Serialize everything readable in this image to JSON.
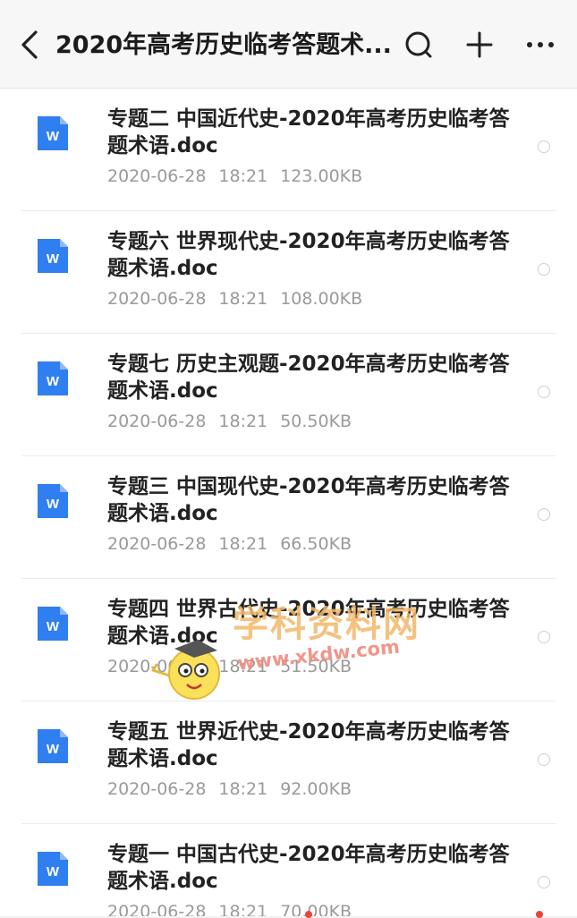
{
  "header": {
    "title": "2020年高考历史临考答题术...",
    "icons": [
      "back-icon",
      "search-icon",
      "add-icon",
      "more-icon"
    ]
  },
  "files": [
    {
      "name": "专题二 中国近代史-2020年高考历史临考答题术语.doc",
      "date": "2020-06-28",
      "time": "18:21",
      "size": "123.00KB"
    },
    {
      "name": "专题六 世界现代史-2020年高考历史临考答题术语.doc",
      "date": "2020-06-28",
      "time": "18:21",
      "size": "108.00KB"
    },
    {
      "name": "专题七 历史主观题-2020年高考历史临考答题术语.doc",
      "date": "2020-06-28",
      "time": "18:21",
      "size": "50.50KB"
    },
    {
      "name": "专题三 中国现代史-2020年高考历史临考答题术语.doc",
      "date": "2020-06-28",
      "time": "18:21",
      "size": "66.50KB"
    },
    {
      "name": "专题四 世界古代史-2020年高考历史临考答题术语.doc",
      "date": "2020-06-28",
      "time": "18:21",
      "size": "51.50KB"
    },
    {
      "name": "专题五 世界近代史-2020年高考历史临考答题术语.doc",
      "date": "2020-06-28",
      "time": "18:21",
      "size": "92.00KB"
    },
    {
      "name": "专题一 中国古代史-2020年高考历史临考答题术语.doc",
      "date": "2020-06-28",
      "time": "18:21",
      "size": "70.00KB"
    }
  ],
  "file_icon_letter": "W",
  "colors": {
    "doc_icon": "#2f7ff0",
    "title": "#1b1b1b",
    "meta": "#9a9a9a"
  },
  "watermark": {
    "text": "学科资料网",
    "url": "www.xkdw.com"
  }
}
